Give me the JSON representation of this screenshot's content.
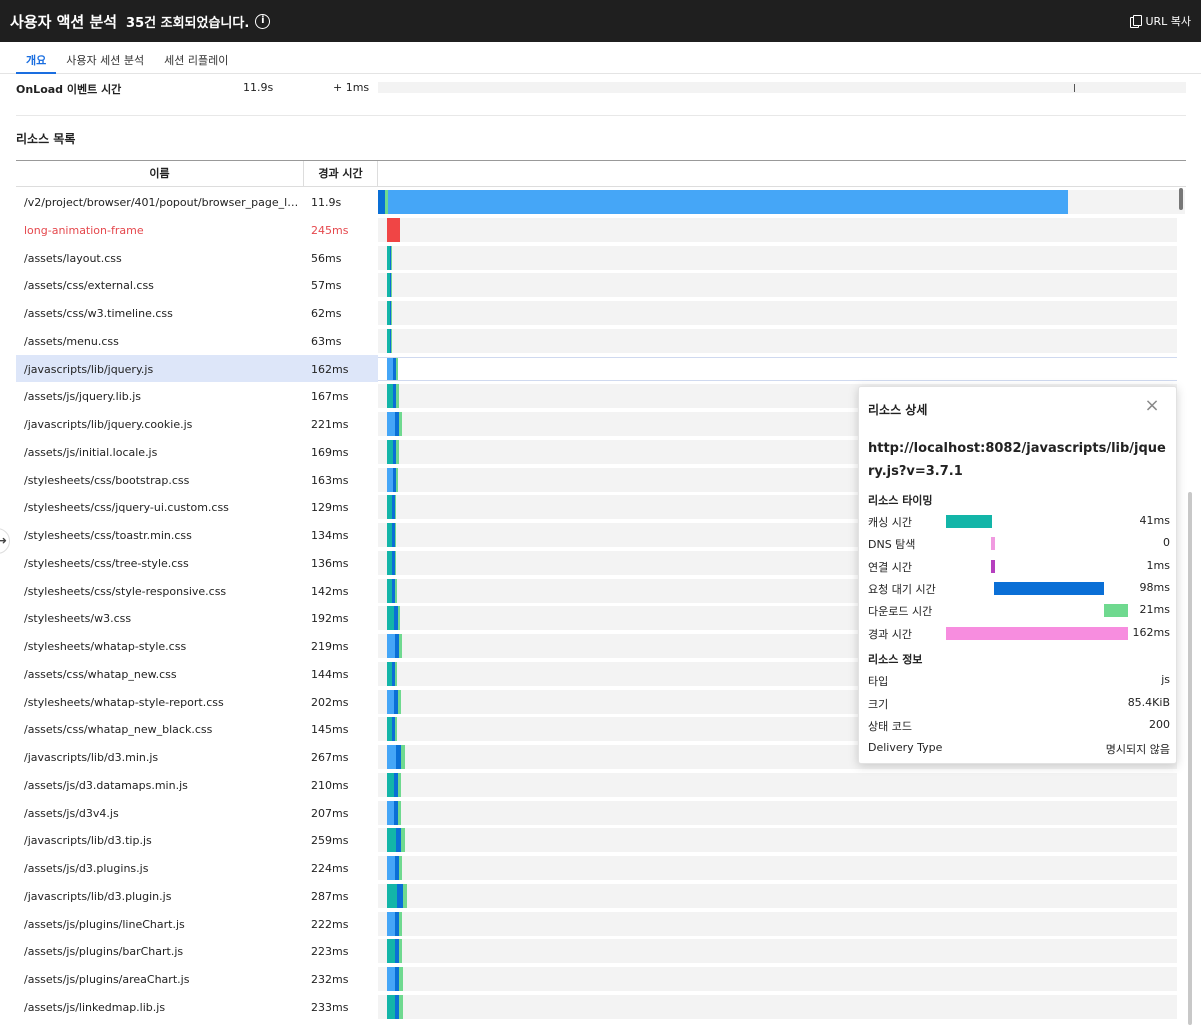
{
  "header": {
    "title": "사용자 액션 분석",
    "count": "35건 조회되었습니다.",
    "info_icon": "i",
    "copy_label": "URL 복사"
  },
  "tabs": [
    {
      "label": "개요",
      "active": true
    },
    {
      "label": "사용자 세션 분석",
      "active": false
    },
    {
      "label": "세션 리플레이",
      "active": false
    }
  ],
  "onload": {
    "label": "OnLoad 이벤트 시간",
    "time": "11.9s",
    "delta": "+ 1ms"
  },
  "resources": {
    "title": "리소스 목록",
    "col_name": "이름",
    "col_time": "경과 시간",
    "rows": [
      {
        "name": "/v2/project/browser/401/popout/browser_page_loa...",
        "time": "11.9s"
      },
      {
        "name": "long-animation-frame",
        "time": "245ms",
        "error": true
      },
      {
        "name": "/assets/layout.css",
        "time": "56ms"
      },
      {
        "name": "/assets/css/external.css",
        "time": "57ms"
      },
      {
        "name": "/assets/css/w3.timeline.css",
        "time": "62ms"
      },
      {
        "name": "/assets/menu.css",
        "time": "63ms"
      },
      {
        "name": "/javascripts/lib/jquery.js",
        "time": "162ms",
        "selected": true
      },
      {
        "name": "/assets/js/jquery.lib.js",
        "time": "167ms"
      },
      {
        "name": "/javascripts/lib/jquery.cookie.js",
        "time": "221ms"
      },
      {
        "name": "/assets/js/initial.locale.js",
        "time": "169ms"
      },
      {
        "name": "/stylesheets/css/bootstrap.css",
        "time": "163ms"
      },
      {
        "name": "/stylesheets/css/jquery-ui.custom.css",
        "time": "129ms"
      },
      {
        "name": "/stylesheets/css/toastr.min.css",
        "time": "134ms"
      },
      {
        "name": "/stylesheets/css/tree-style.css",
        "time": "136ms"
      },
      {
        "name": "/stylesheets/css/style-responsive.css",
        "time": "142ms"
      },
      {
        "name": "/stylesheets/w3.css",
        "time": "192ms"
      },
      {
        "name": "/stylesheets/whatap-style.css",
        "time": "219ms"
      },
      {
        "name": "/assets/css/whatap_new.css",
        "time": "144ms"
      },
      {
        "name": "/stylesheets/whatap-style-report.css",
        "time": "202ms"
      },
      {
        "name": "/assets/css/whatap_new_black.css",
        "time": "145ms"
      },
      {
        "name": "/javascripts/lib/d3.min.js",
        "time": "267ms"
      },
      {
        "name": "/assets/js/d3.datamaps.min.js",
        "time": "210ms"
      },
      {
        "name": "/assets/js/d3v4.js",
        "time": "207ms"
      },
      {
        "name": "/javascripts/lib/d3.tip.js",
        "time": "259ms"
      },
      {
        "name": "/assets/js/d3.plugins.js",
        "time": "224ms"
      },
      {
        "name": "/javascripts/lib/d3.plugin.js",
        "time": "287ms"
      },
      {
        "name": "/assets/js/plugins/lineChart.js",
        "time": "222ms"
      },
      {
        "name": "/assets/js/plugins/barChart.js",
        "time": "223ms"
      },
      {
        "name": "/assets/js/plugins/areaChart.js",
        "time": "232ms"
      },
      {
        "name": "/assets/js/linkedmap.lib.js",
        "time": "233ms"
      }
    ]
  },
  "colors": {
    "cache": "#13b5a8",
    "dns": "#f09ae0",
    "connect": "#b63fbf",
    "wait": "#0a6fd6",
    "download": "#6fd98f",
    "elapsed": "#f78ddf",
    "main": "#45a6f7",
    "error": "#f04545"
  },
  "detail": {
    "title": "리소스 상세",
    "url": "http://localhost:8082/javascripts/lib/jquery.js?v=3.7.1",
    "timing_title": "리소스 타이밍",
    "timing": [
      {
        "label": "캐싱 시간",
        "value": "41ms"
      },
      {
        "label": "DNS 탐색",
        "value": "0"
      },
      {
        "label": "연결 시간",
        "value": "1ms"
      },
      {
        "label": "요청 대기 시간",
        "value": "98ms"
      },
      {
        "label": "다운로드 시간",
        "value": "21ms"
      },
      {
        "label": "경과 시간",
        "value": "162ms"
      }
    ],
    "info_title": "리소스 정보",
    "info": [
      {
        "label": "타입",
        "value": "js"
      },
      {
        "label": "크기",
        "value": "85.4KiB"
      },
      {
        "label": "상태 코드",
        "value": "200"
      },
      {
        "label": "Delivery Type",
        "value": "명시되지 않음"
      }
    ]
  }
}
